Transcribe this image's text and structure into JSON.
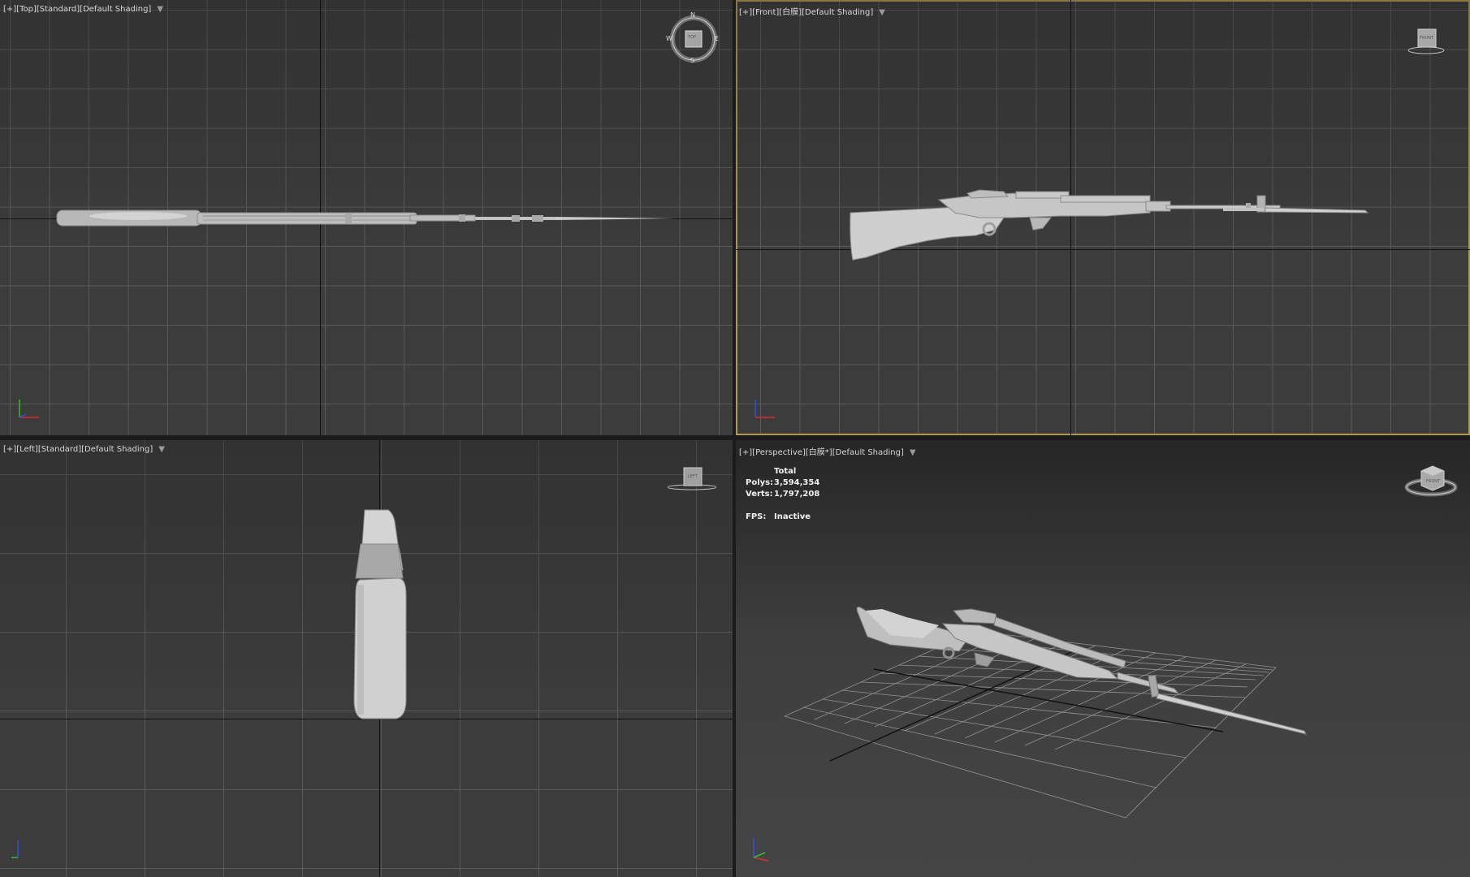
{
  "viewports": {
    "top": {
      "plus": "[+]",
      "view": "[Top]",
      "mode": "[Standard]",
      "shading": "[Default Shading]",
      "filter_icon": "filter-funnel-icon",
      "compass": {
        "n": "N",
        "s": "S",
        "e": "E",
        "w": "W",
        "cube_label": "TOP"
      }
    },
    "front": {
      "plus": "[+]",
      "view": "[Front]",
      "mode": "[白膜]",
      "shading": "[Default Shading]",
      "filter_icon": "filter-funnel-icon",
      "cube_label": "FRONT",
      "active_border_color": "#b09a50"
    },
    "left": {
      "plus": "[+]",
      "view": "[Left]",
      "mode": "[Standard]",
      "shading": "[Default Shading]",
      "filter_icon": "filter-funnel-icon",
      "cube_label": "LEFT"
    },
    "perspective": {
      "plus": "[+]",
      "view": "[Perspective]",
      "mode": "[白膜*]",
      "shading": "[Default Shading]",
      "filter_icon": "filter-funnel-icon",
      "cube_label": "FRONT",
      "stats": {
        "header": "Total",
        "polys_label": "Polys:",
        "polys_value": "3,594,354",
        "verts_label": "Verts:",
        "verts_value": "1,797,208",
        "fps_label": "FPS:",
        "fps_value": "Inactive"
      }
    }
  },
  "colors": {
    "grid_line": "#5a5a5a",
    "viewport_bg": "#3c3c3c",
    "model": "#c8c8c8",
    "axis_x": "#d23030",
    "axis_y": "#30c030",
    "axis_z": "#3050e0"
  }
}
